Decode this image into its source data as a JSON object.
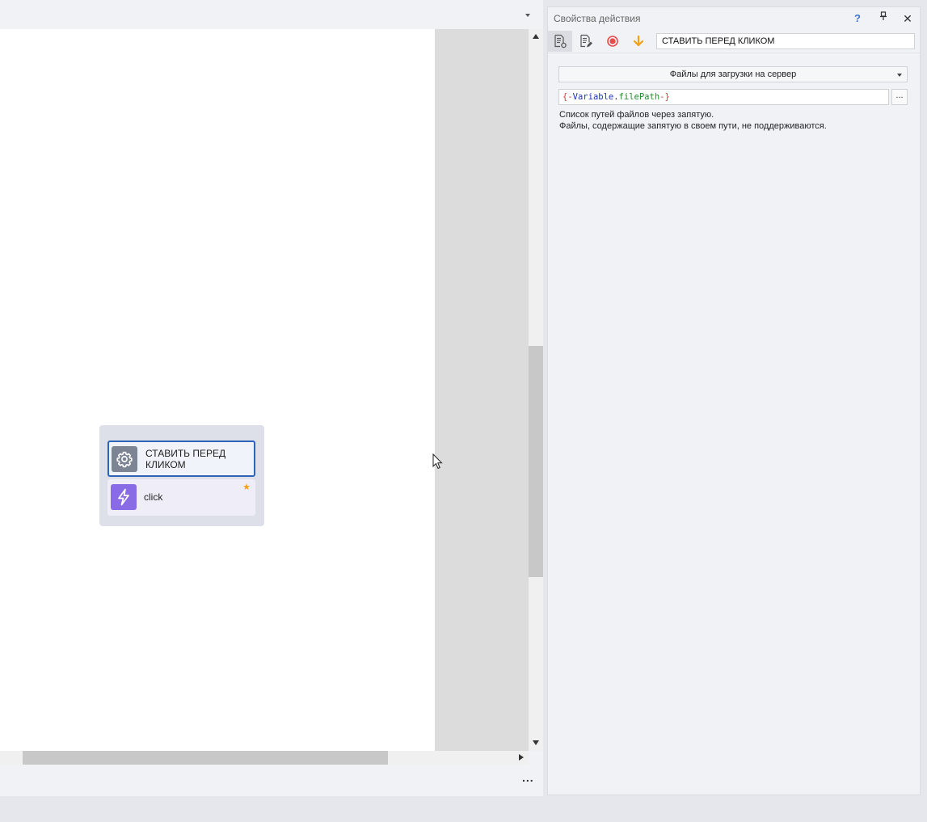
{
  "workspace": {
    "group": {
      "actions": [
        {
          "label": "СТАВИТЬ ПЕРЕД КЛИКОМ",
          "icon": "gear-icon",
          "selected": true
        },
        {
          "label": "click",
          "icon": "lightning-icon",
          "starred": true
        }
      ]
    },
    "bottom_more": "..."
  },
  "properties": {
    "title": "Свойства действия",
    "help_label": "?",
    "action_name": "СТАВИТЬ ПЕРЕД КЛИКОМ",
    "toolbar_icons": [
      "action-settings-icon",
      "action-edit-icon",
      "record-icon",
      "arrow-down-icon"
    ],
    "mode_dropdown": "Файлы для загрузки на сервер",
    "file_path": {
      "open": "{-",
      "variable": "Variable",
      "dot": ".",
      "field": "filePath",
      "close": "-}"
    },
    "browse_label": "...",
    "hint_line1": "Список путей файлов через запятую.",
    "hint_line2": "Файлы, содержащие запятую в своем пути, не поддерживаются."
  },
  "colors": {
    "selected_border": "#2f63b5",
    "event_icon_bg": "#8a6be6",
    "record": "#e84b4b",
    "arrow": "#f0a21a",
    "help": "#3b74d9"
  }
}
